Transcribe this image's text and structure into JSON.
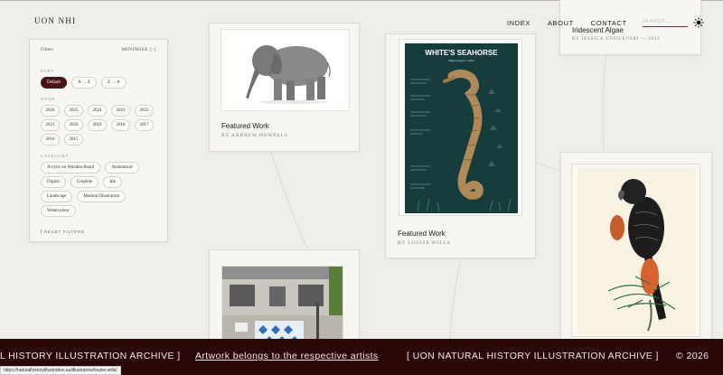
{
  "site": {
    "logo": "UON NHI"
  },
  "nav": {
    "items": [
      "INDEX",
      "ABOUT",
      "CONTACT"
    ],
    "search_placeholder": "SEARCH..."
  },
  "filters": {
    "title": "Filters",
    "minimise": "MINIMISE [-]",
    "sort_label": "SORT",
    "sort_options": [
      "Default",
      "A → Z",
      "Z → A"
    ],
    "sort_selected": "Default",
    "year_label": "YEAR",
    "years": [
      "2026",
      "2025",
      "2024",
      "2023",
      "2022",
      "2021",
      "2020",
      "2019",
      "2018",
      "2017",
      "2016",
      "2015"
    ],
    "category_label": "CATEGORY",
    "categories": [
      "Acrylic on Wooden Board",
      "Anatomical",
      "Digital",
      "Graphite",
      "Ink",
      "Landscape",
      "Medical Illustration",
      "Watercolour"
    ],
    "reset": "RESET FILTERS"
  },
  "cards": [
    {
      "title": "Featured Work",
      "byline": "BY ANDREW HOWELLS"
    },
    {
      "title": "Featured Work",
      "byline": "BY LOUISE WILLS"
    },
    {
      "title": "Iridescent Algae",
      "byline": "BY JESSICA STOJCEVSKI — 2022"
    }
  ],
  "poster": {
    "heading": "WHITE'S SEAHORSE",
    "subheading": "Hippocampus whitei"
  },
  "footer": {
    "left": "L HISTORY ILLUSTRATION ARCHIVE ]",
    "link": "Artwork belongs to the respective artists",
    "mid": "[ UON NATURAL HISTORY ILLUSTRATION ARCHIVE ]",
    "right": "© 2026"
  },
  "status_url": "https://naturalhistoryillustration.au/illustrators/louise-wills/",
  "colors": {
    "accent": "#4a1414",
    "footer_bg": "#2a0808",
    "poster_bg": "#163c3c"
  }
}
